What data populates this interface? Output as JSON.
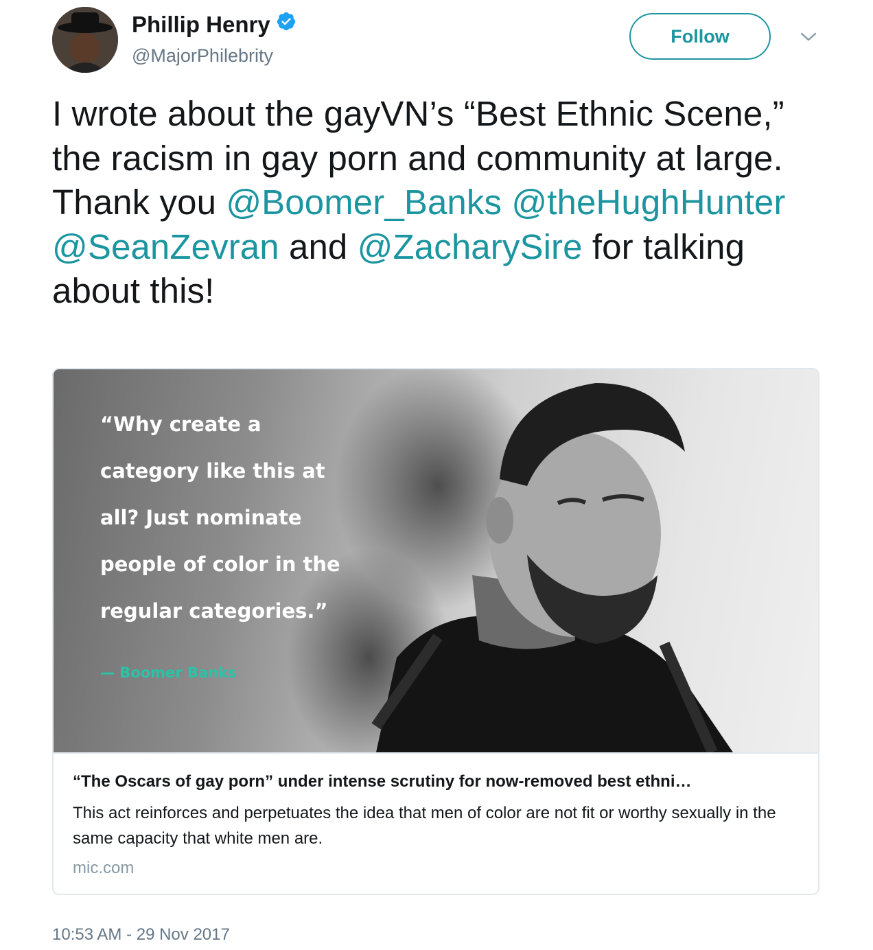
{
  "author": {
    "display_name": "Phillip Henry",
    "handle": "@MajorPhilebrity",
    "verified": true
  },
  "follow_button": {
    "label": "Follow"
  },
  "tweet": {
    "text_parts": [
      "I wrote about the gayVN’s “Best Ethnic Scene,” the racism in gay porn and community at large. Thank you ",
      "@Boomer_Banks",
      " ",
      "@theHughHunter",
      " ",
      "@SeanZevran",
      " and ",
      "@ZacharySire",
      " for talking about this!"
    ],
    "timestamp": "10:53 AM - 29 Nov 2017"
  },
  "card": {
    "quote_lines": [
      "“Why create a",
      "category like this at",
      "all? Just nominate",
      "people of color in the",
      "regular categories.”"
    ],
    "quote_attribution": "— Boomer Banks",
    "title": "“The Oscars of gay porn” under intense scrutiny for now-removed best ethni…",
    "description": "This act reinforces and perpetuates the idea that men of color are not fit or worthy sexually in the same capacity that white men are.",
    "domain": "mic.com"
  },
  "colors": {
    "accent": "#1b95a0",
    "verified_badge": "#1da1f2",
    "secondary_text": "#657786",
    "quote_attribution": "#29c3a8"
  }
}
